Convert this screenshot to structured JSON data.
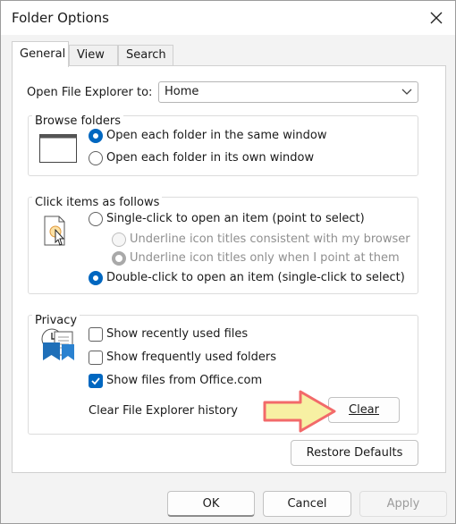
{
  "window": {
    "title": "Folder Options"
  },
  "tabs": [
    {
      "label": "General",
      "active": true
    },
    {
      "label": "View",
      "active": false
    },
    {
      "label": "Search",
      "active": false
    }
  ],
  "general": {
    "open_explorer_label": "Open File Explorer to:",
    "open_explorer_value": "Home",
    "browse_group": {
      "title": "Browse folders",
      "option_same": "Open each folder in the same window",
      "option_own": "Open each folder in its own window",
      "selected": "same"
    },
    "click_group": {
      "title": "Click items as follows",
      "option_single": "Single-click to open an item (point to select)",
      "sub_browser": "Underline icon titles consistent with my browser",
      "sub_point": "Underline icon titles only when I point at them",
      "option_double": "Double-click to open an item (single-click to select)",
      "selected": "double"
    },
    "privacy_group": {
      "title": "Privacy",
      "recent_files": {
        "label": "Show recently used files",
        "checked": false
      },
      "frequent_folders": {
        "label": "Show frequently used folders",
        "checked": false
      },
      "office_files": {
        "label": "Show files from Office.com",
        "checked": true
      },
      "clear_history_label": "Clear File Explorer history",
      "clear_button": "Clear"
    },
    "restore_defaults_button": "Restore Defaults"
  },
  "footer": {
    "ok": "OK",
    "cancel": "Cancel",
    "apply": "Apply"
  },
  "colors": {
    "accent": "#0067c0",
    "annotation_arrow_fill": "#f7f0a3",
    "annotation_arrow_stroke": "#f26a6a"
  }
}
